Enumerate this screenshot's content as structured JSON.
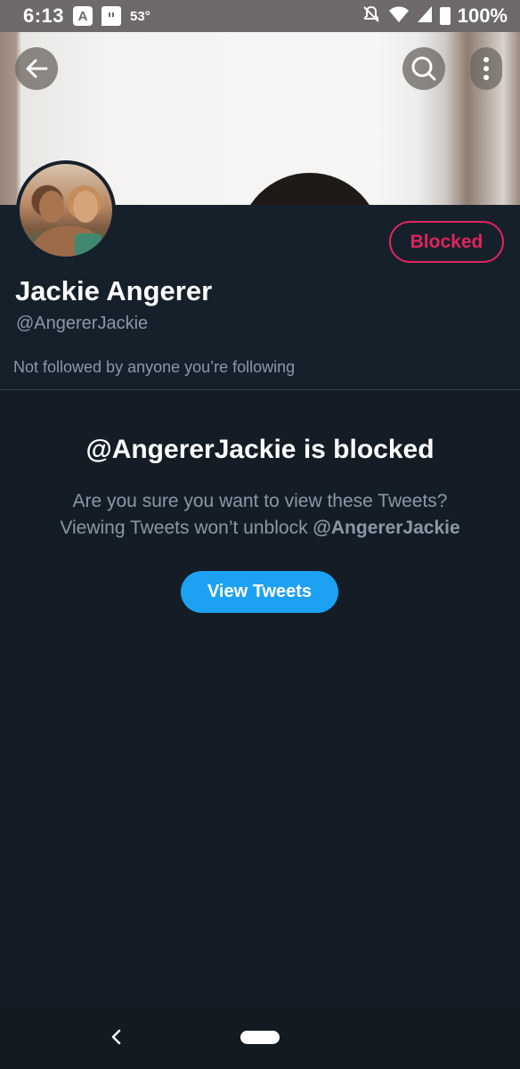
{
  "status_bar": {
    "time": "6:13",
    "temperature": "53°",
    "battery": "100%",
    "icons": [
      "app-a-icon",
      "twitch-icon",
      "notifications-off-icon",
      "wifi-icon",
      "signal-icon",
      "battery-icon"
    ]
  },
  "header": {
    "back_icon": "arrow-left-icon",
    "search_icon": "search-icon",
    "more_icon": "more-vertical-icon"
  },
  "profile": {
    "display_name": "Jackie Angerer",
    "handle": "@AngererJackie",
    "blocked_label": "Blocked",
    "followed_by": "Not followed by anyone you’re following"
  },
  "blocked_notice": {
    "title": "@AngererJackie is blocked",
    "line1": "Are you sure you want to view these Tweets?",
    "line2_prefix": "Viewing Tweets won’t unblock ",
    "line2_handle": "@AngererJackie",
    "view_button": "View Tweets"
  },
  "colors": {
    "background": "#141d26",
    "blocked_red": "#e0245e",
    "accent_blue": "#1da1f2",
    "secondary_text": "#8899a6"
  }
}
